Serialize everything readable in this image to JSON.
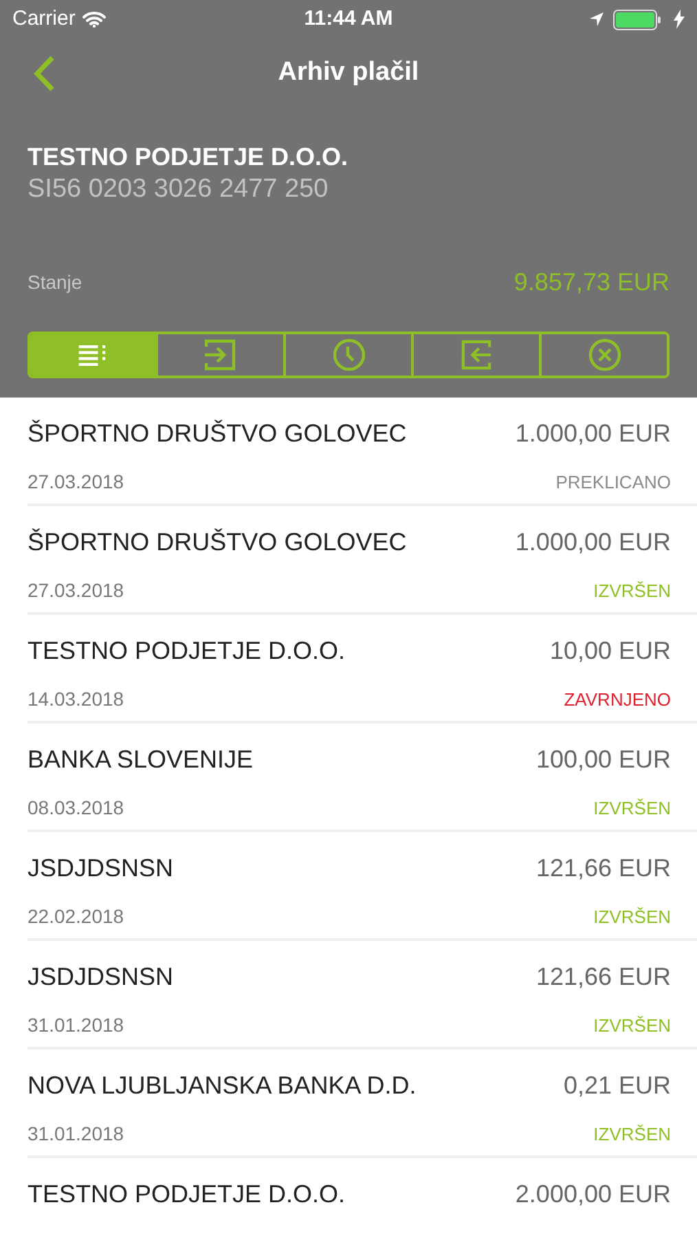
{
  "status_bar": {
    "carrier": "Carrier",
    "time": "11:44 AM"
  },
  "nav": {
    "title": "Arhiv plačil"
  },
  "account": {
    "name": "TESTNO PODJETJE D.O.O.",
    "iban": "SI56 0203 3026 2477 250",
    "balance_label": "Stanje",
    "balance": "9.857,73 EUR"
  },
  "filters": [
    {
      "kind": "all",
      "selected": true
    },
    {
      "kind": "incoming",
      "selected": false
    },
    {
      "kind": "pending",
      "selected": false
    },
    {
      "kind": "outgoing",
      "selected": false
    },
    {
      "kind": "rejected",
      "selected": false
    }
  ],
  "payments": [
    {
      "name": "ŠPORTNO DRUŠTVO GOLOVEC",
      "amount": "1.000,00 EUR",
      "date": "27.03.2018",
      "status": "PREKLICANO",
      "color": "#8a8a8a"
    },
    {
      "name": "ŠPORTNO DRUŠTVO GOLOVEC",
      "amount": "1.000,00 EUR",
      "date": "27.03.2018",
      "status": "IZVRŠEN",
      "color": "#8fbf26"
    },
    {
      "name": "TESTNO PODJETJE D.O.O.",
      "amount": "10,00 EUR",
      "date": "14.03.2018",
      "status": "ZAVRNJENO",
      "color": "#e0202e"
    },
    {
      "name": "BANKA SLOVENIJE",
      "amount": "100,00 EUR",
      "date": "08.03.2018",
      "status": "IZVRŠEN",
      "color": "#8fbf26"
    },
    {
      "name": "JSDJDSNSN",
      "amount": "121,66 EUR",
      "date": "22.02.2018",
      "status": "IZVRŠEN",
      "color": "#8fbf26"
    },
    {
      "name": "JSDJDSNSN",
      "amount": "121,66 EUR",
      "date": "31.01.2018",
      "status": "IZVRŠEN",
      "color": "#8fbf26"
    },
    {
      "name": "NOVA LJUBLJANSKA BANKA D.D.",
      "amount": "0,21 EUR",
      "date": "31.01.2018",
      "status": "IZVRŠEN",
      "color": "#8fbf26"
    },
    {
      "name": "TESTNO PODJETJE D.O.O.",
      "amount": "2.000,00 EUR"
    }
  ]
}
